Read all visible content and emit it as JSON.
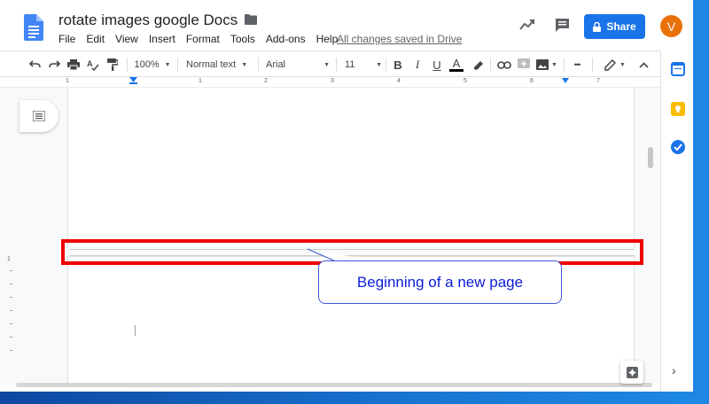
{
  "document": {
    "title": "rotate images google Docs",
    "save_status": "All changes saved in Drive"
  },
  "menu": [
    "File",
    "Edit",
    "View",
    "Insert",
    "Format",
    "Tools",
    "Add-ons",
    "Help"
  ],
  "header": {
    "share_label": "Share",
    "avatar_initial": "V"
  },
  "toolbar": {
    "zoom": "100%",
    "style": "Normal text",
    "font": "Arial",
    "font_size": "11",
    "bold": "B",
    "italic": "I",
    "underline": "U",
    "text_color": "A",
    "more": "•••"
  },
  "ruler": {
    "numbers": [
      "1",
      "1",
      "2",
      "3",
      "4",
      "5",
      "6",
      "7"
    ]
  },
  "annotation": {
    "callout_text": "Beginning of a new page",
    "highlight_color": "#ee0000",
    "callout_text_color": "#0b1dd8"
  },
  "colors": {
    "share_blue": "#1a73e8",
    "avatar_orange": "#e8710a",
    "docs_blue": "#4285f4"
  },
  "icons": {
    "undo": "undo-icon",
    "redo": "redo-icon",
    "print": "print-icon",
    "spellcheck": "spellcheck-icon",
    "paint_format": "paint-format-icon",
    "highlight": "highlighter-icon",
    "link": "link-icon",
    "comment": "add-comment-icon",
    "image": "image-icon",
    "edit_mode": "pencil-icon",
    "collapse": "chevron-up-icon"
  }
}
